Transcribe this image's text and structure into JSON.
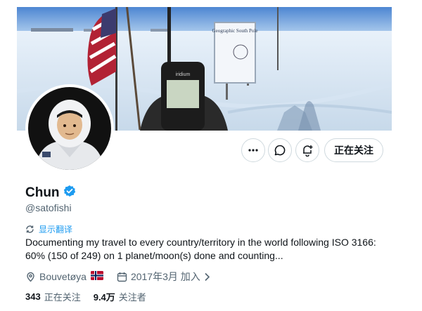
{
  "profile": {
    "name": "Chun",
    "handle": "@satofishi",
    "bio": "Documenting my travel to every country/territory in the world following ISO 3166: 60% (150 of 249) on 1 planet/moon(s) done and counting...",
    "translate_label": "显示翻译",
    "location": "Bouvetøya",
    "joined": "2017年3月 加入"
  },
  "banner": {
    "sign_title": "Geographic South Pole",
    "device_brand": "iridium"
  },
  "actions": {
    "more_icon": "more-icon",
    "message_icon": "message-icon",
    "notify_icon": "notification-bell-icon",
    "follow_label": "正在关注"
  },
  "stats": {
    "following_count": "343",
    "following_label": "正在关注",
    "followers_count": "9.4万",
    "followers_label": "关注者"
  },
  "colors": {
    "accent": "#1d9bf0",
    "text": "#0f1419",
    "muted": "#536471",
    "border": "#cfd9de"
  }
}
